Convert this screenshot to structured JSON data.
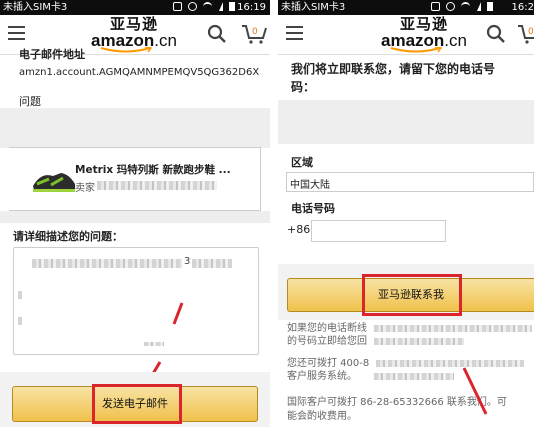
{
  "left_screen": {
    "status": {
      "carrier": "未插入SIM卡3",
      "time": "16:19"
    },
    "header": {
      "logo_cn": "亚马逊",
      "logo_en": "amazon",
      "logo_suffix": ".cn"
    },
    "email_label": "电子邮件地址",
    "email_value": "amzn1.account.AGMQAMNMPEMQV5QG362D6X",
    "problem_label": "问题",
    "product_name": "Metrix 玛特列斯 新款跑步鞋 ...",
    "seller_prefix": "卖家",
    "describe_label": "请详细描述您的问题：",
    "textarea_fragment": "3",
    "send_button": "发送电子邮件"
  },
  "right_screen": {
    "status": {
      "carrier": "未插入SIM卡3",
      "time": "16:2"
    },
    "header": {
      "logo_cn": "亚马逊",
      "logo_en": "amazon",
      "logo_suffix": ".cn"
    },
    "intro_line1": "我们将立即联系您，请留下您的电话号",
    "intro_line2": "码：",
    "region_label": "区域",
    "region_value": "中国大陆",
    "phone_label": "电话号码",
    "country_code": "+86",
    "contact_button": "亚马逊联系我",
    "info_1a": "如果您的电话断线",
    "info_1b": "的号码立即给您回",
    "info_2a": "您还可拨打 400-8",
    "info_2b": "客户服务系统。",
    "info_3a": "国际客户可拨打 86-28-65332666 联系我们。可",
    "info_3b": "能会酌收费用。"
  },
  "colors": {
    "status_bar": "#0d0d0d",
    "button_gold": "#f0c14b",
    "highlight_red": "#d9252b",
    "amazon_orange": "#ff9900"
  }
}
